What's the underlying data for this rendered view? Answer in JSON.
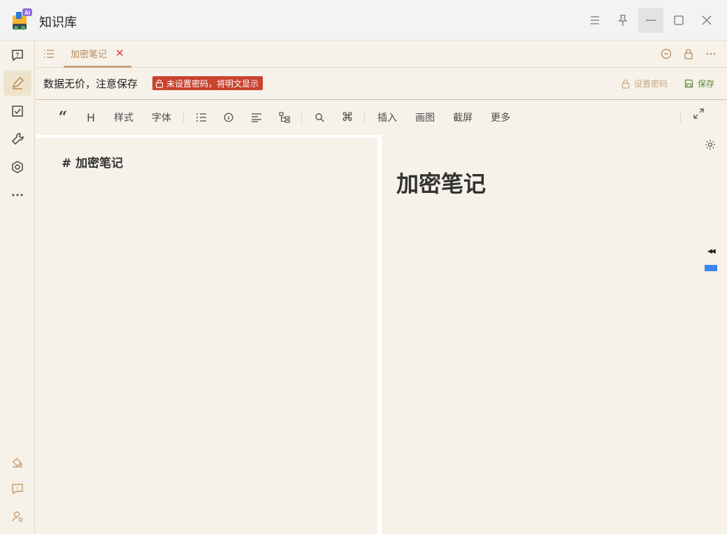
{
  "window": {
    "title": "知识库",
    "logo_badge": "AI"
  },
  "tabs": [
    {
      "label": "加密笔记",
      "active": true
    }
  ],
  "notice": {
    "text": "数据无价，注意保存",
    "badge": "未设置密码，将明文显示",
    "set_password": "设置密码",
    "save": "保存"
  },
  "toolbar": {
    "style": "样式",
    "font": "字体",
    "insert": "插入",
    "draw": "画图",
    "screenshot": "截屏",
    "more": "更多"
  },
  "editor": {
    "source_line": "#  加密笔记",
    "preview_heading": "加密笔记"
  },
  "colors": {
    "accent": "#b38a5d",
    "badge_red": "#c9432f",
    "save_green": "#5a8a3c",
    "background": "#f6f2e9",
    "collapse_bar": "#3b86f2"
  },
  "icons": {
    "rail_top": [
      "help-chat-icon",
      "pencil-icon",
      "checkbox-icon",
      "wrench-icon",
      "hexagon-settings-icon",
      "more-dots-icon"
    ],
    "rail_bottom": [
      "paint-bucket-icon",
      "feedback-icon",
      "user-settings-icon"
    ]
  }
}
